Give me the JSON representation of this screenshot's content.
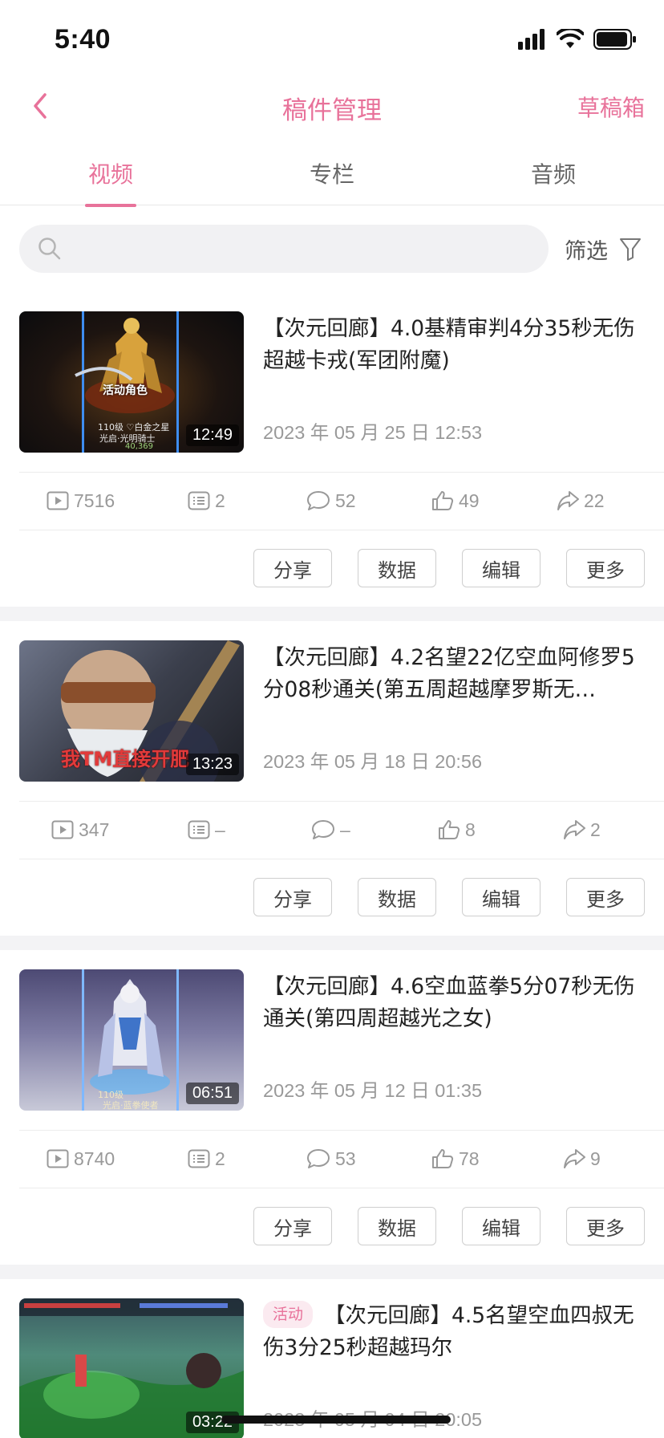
{
  "status": {
    "time": "5:40"
  },
  "nav": {
    "title": "稿件管理",
    "drafts": "草稿箱"
  },
  "tabs": [
    {
      "label": "视频",
      "active": true
    },
    {
      "label": "专栏",
      "active": false
    },
    {
      "label": "音频",
      "active": false
    }
  ],
  "search": {
    "placeholder": ""
  },
  "filter": {
    "label": "筛选"
  },
  "accent_color": "#e8729a",
  "actions": {
    "share": "分享",
    "data": "数据",
    "edit": "编辑",
    "more": "更多"
  },
  "videos": [
    {
      "title": "【次元回廊】4.0基精审判4分35秒无伤超越卡戎(军团附魔)",
      "date": "2023 年 05 月 25 日 12:53",
      "duration": "12:49",
      "tag": "",
      "thumb_text": [
        "活动角色",
        "110级 ♡白金之星",
        "光启·光明骑士",
        "40,369"
      ],
      "stats": {
        "views": "7516",
        "danmaku": "2",
        "comments": "52",
        "likes": "49",
        "shares": "22"
      }
    },
    {
      "title": "【次元回廊】4.2名望22亿空血阿修罗5分08秒通关(第五周超越摩罗斯无…",
      "date": "2023 年 05 月 18 日 20:56",
      "duration": "13:23",
      "tag": "",
      "thumb_text": [
        "我TM直接开肥"
      ],
      "stats": {
        "views": "347",
        "danmaku": "–",
        "comments": "–",
        "likes": "8",
        "shares": "2"
      }
    },
    {
      "title": "【次元回廊】4.6空血蓝拳5分07秒无伤通关(第四周超越光之女)",
      "date": "2023 年 05 月 12 日 01:35",
      "duration": "06:51",
      "tag": "",
      "thumb_text": [
        "110级",
        "光启·蓝拳使者"
      ],
      "stats": {
        "views": "8740",
        "danmaku": "2",
        "comments": "53",
        "likes": "78",
        "shares": "9"
      }
    },
    {
      "title": "【次元回廊】4.5名望空血四叔无伤3分25秒超越玛尔",
      "date": "2023 年 05 月 04 日 20:05",
      "duration": "03:22",
      "tag": "活动",
      "thumb_text": [],
      "stats": {
        "views": "",
        "danmaku": "",
        "comments": "",
        "likes": "",
        "shares": ""
      }
    }
  ]
}
